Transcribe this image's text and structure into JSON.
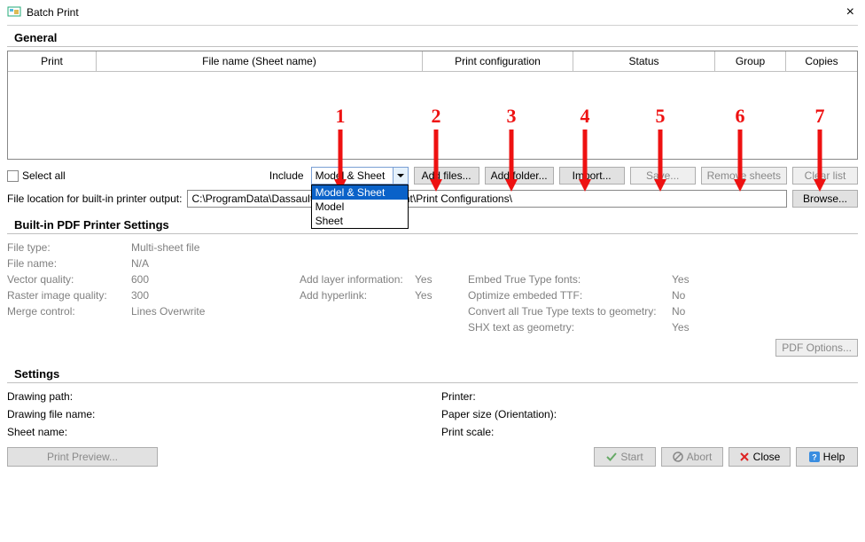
{
  "window": {
    "title": "Batch Print"
  },
  "sections": {
    "general": "General",
    "pdf": "Built-in PDF Printer Settings",
    "settings": "Settings"
  },
  "table": {
    "columns": [
      "Print",
      "File name (Sheet name)",
      "Print configuration",
      "Status",
      "Group",
      "Copies"
    ]
  },
  "controls": {
    "select_all": "Select all",
    "include_label": "Include",
    "include_value": "Model & Sheet",
    "include_options": [
      "Model & Sheet",
      "Model",
      "Sheet"
    ],
    "add_files": "Add files...",
    "add_folder": "Add folder...",
    "import": "Import...",
    "save": "Save...",
    "remove_sheets": "Remove sheets",
    "clear_list": "Clear list"
  },
  "filepath": {
    "label": "File location for built-in printer output:",
    "value": "C:\\ProgramData\\Dassault Systemes\\DraftSight\\Print Configurations\\",
    "browse": "Browse..."
  },
  "pdf": {
    "file_type_k": "File type:",
    "file_type_v": "Multi-sheet file",
    "file_name_k": "File name:",
    "file_name_v": "N/A",
    "vector_k": "Vector quality:",
    "vector_v": "600",
    "raster_k": "Raster image quality:",
    "raster_v": "300",
    "merge_k": "Merge control:",
    "merge_v": "Lines Overwrite",
    "layer_k": "Add layer information:",
    "layer_v": "Yes",
    "hyper_k": "Add hyperlink:",
    "hyper_v": "Yes",
    "embed_k": "Embed True Type fonts:",
    "embed_v": "Yes",
    "optim_k": "Optimize embeded TTF:",
    "optim_v": "No",
    "conv_k": "Convert all True Type texts to geometry:",
    "conv_v": "No",
    "shx_k": "SHX text as geometry:",
    "shx_v": "Yes",
    "options_btn": "PDF Options..."
  },
  "settings": {
    "drawing_path_k": "Drawing path:",
    "drawing_file_k": "Drawing file name:",
    "sheet_name_k": "Sheet name:",
    "printer_k": "Printer:",
    "paper_k": "Paper size (Orientation):",
    "scale_k": "Print scale:"
  },
  "bottom": {
    "print_preview": "Print Preview...",
    "start": "Start",
    "abort": "Abort",
    "close": "Close",
    "help": "Help"
  },
  "callouts": [
    "1",
    "2",
    "3",
    "4",
    "5",
    "6",
    "7"
  ]
}
